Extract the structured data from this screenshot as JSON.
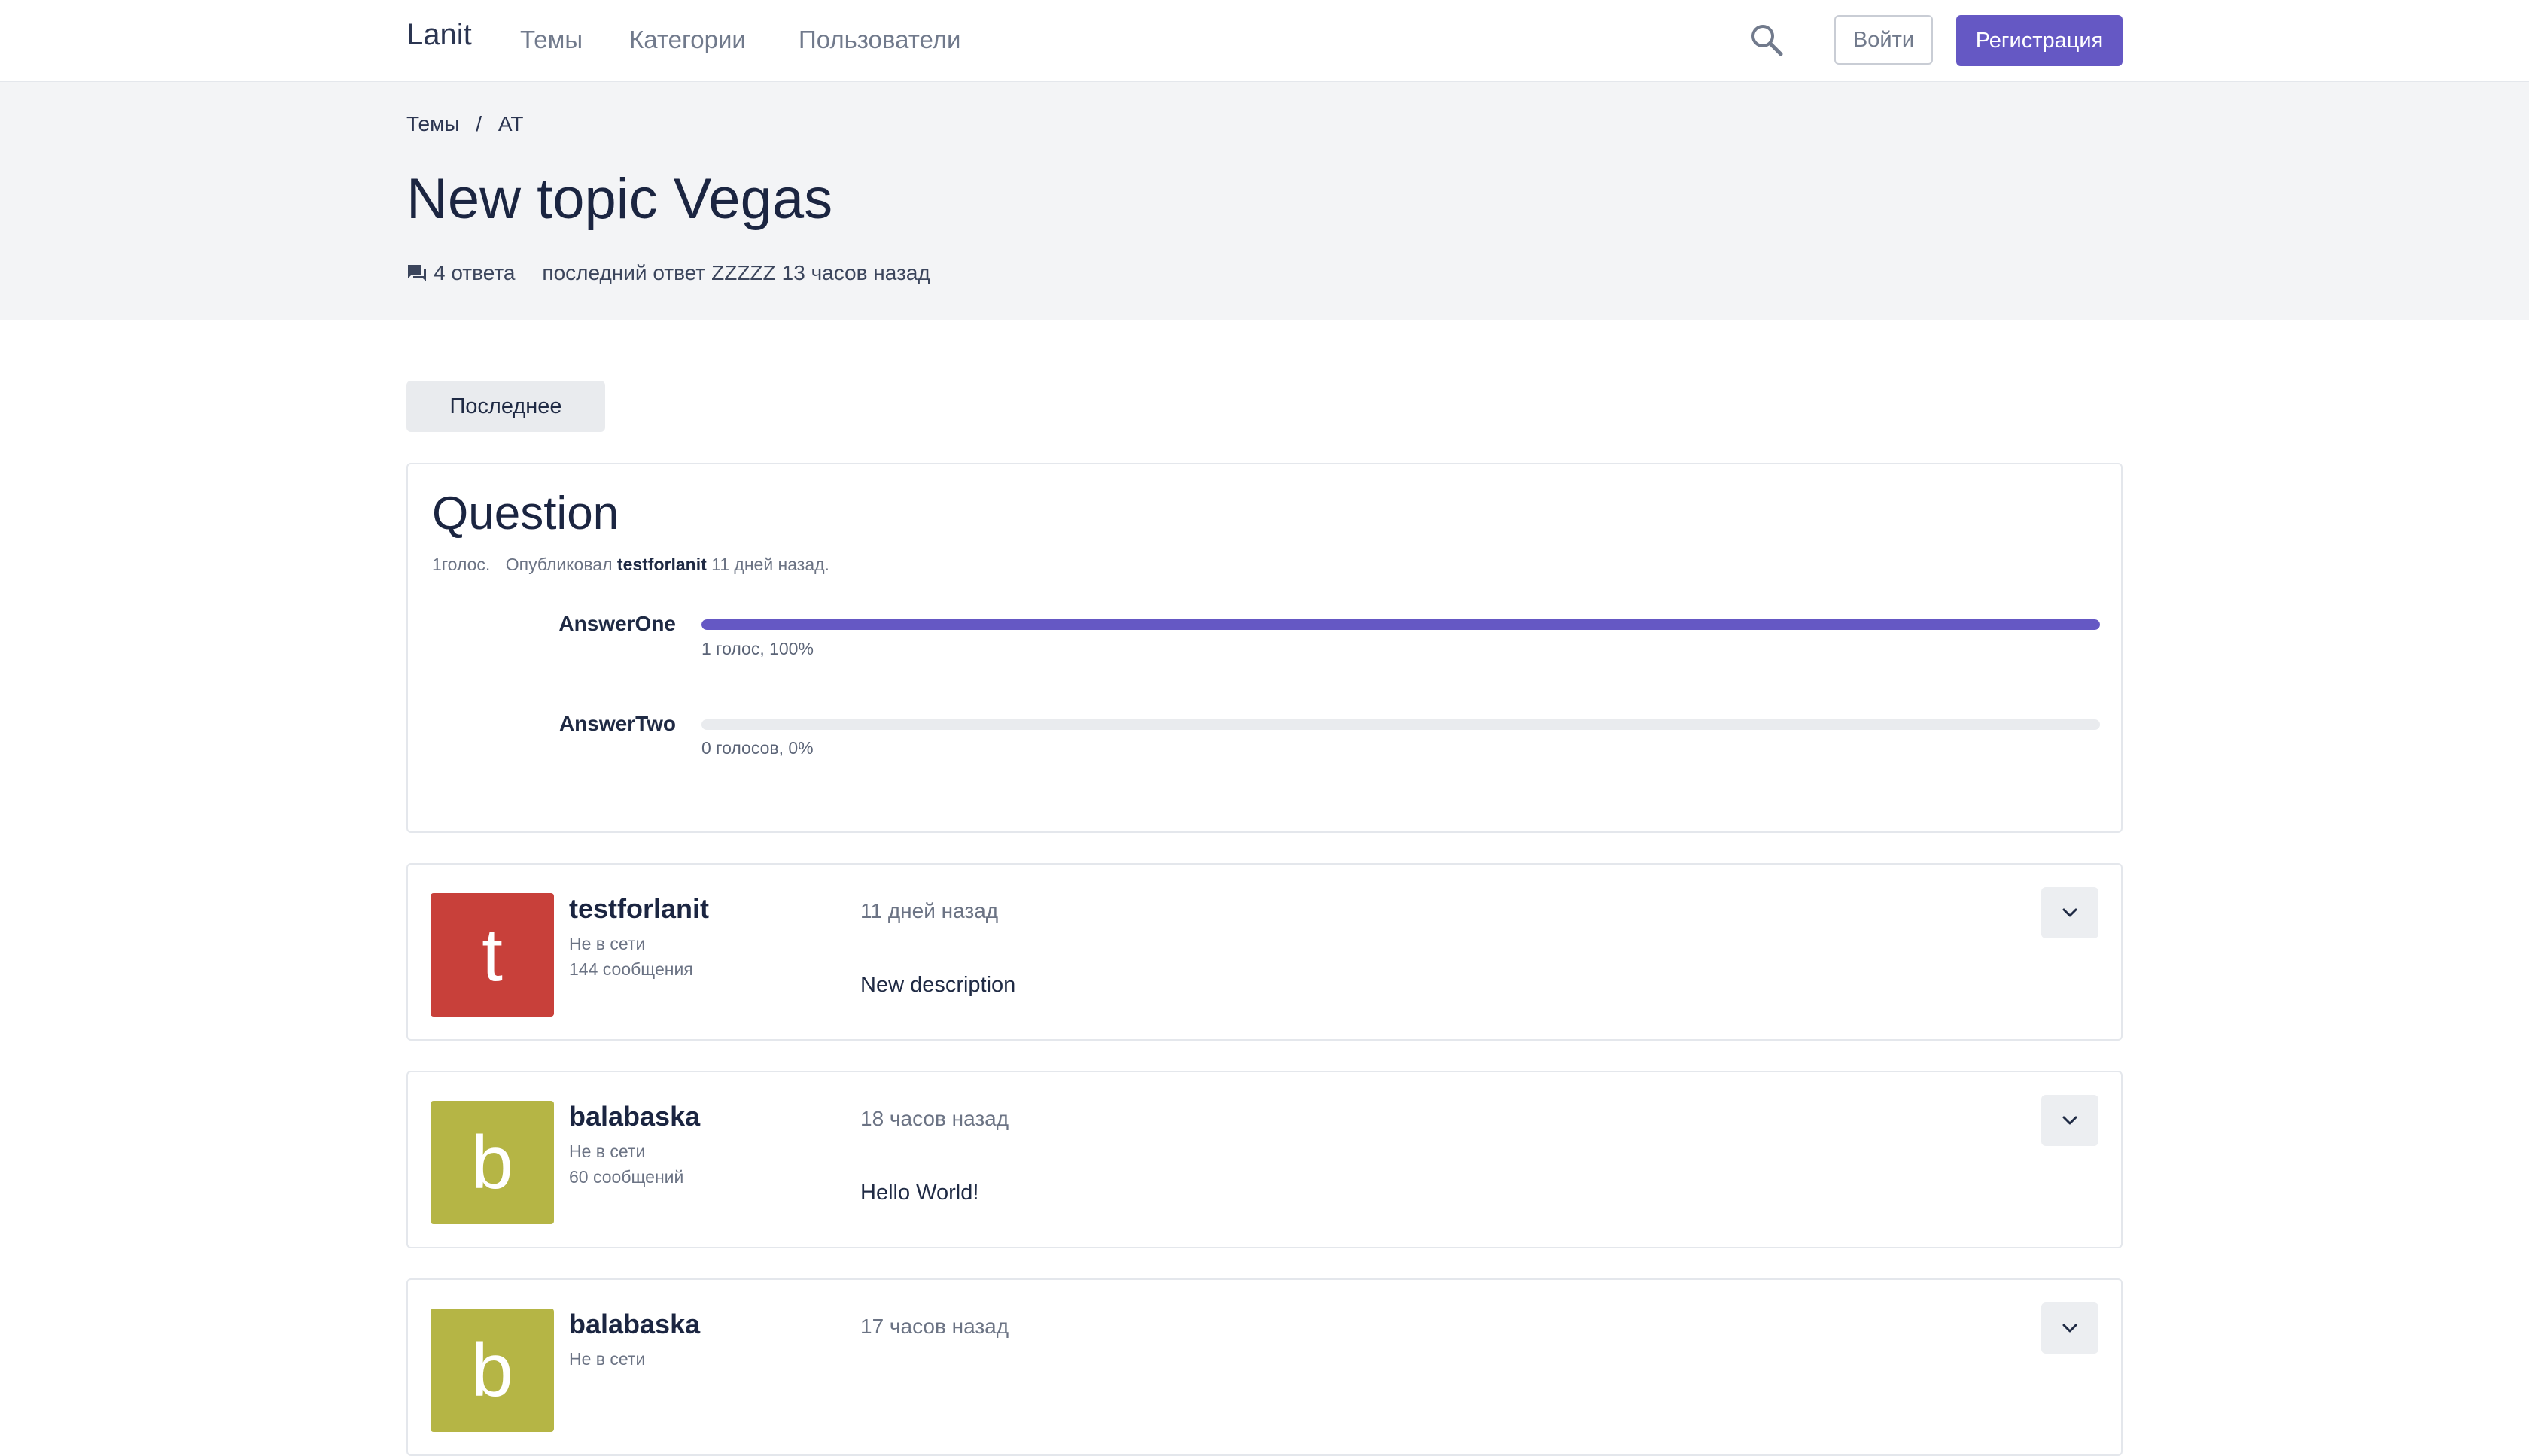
{
  "header": {
    "brand": "Lanit",
    "nav": [
      "Темы",
      "Категории",
      "Пользователи"
    ],
    "login_label": "Войти",
    "register_label": "Регистрация"
  },
  "breadcrumb": [
    "Темы",
    "/",
    "AT"
  ],
  "topic": {
    "title": "New topic Vegas",
    "replies": "4 ответа",
    "last_reply_prefix": "последний ответ",
    "last_reply_user": "ZZZZZ",
    "last_reply_time": "13 часов назад"
  },
  "latest_button": "Последнее",
  "poll": {
    "title": "Question",
    "votes": "1голос.",
    "published_by": "Опубликовал",
    "author": "testforlanit",
    "time": "11 дней назад.",
    "answers": [
      {
        "label": "AnswerOne",
        "caption": "1 голос, 100%",
        "percent": 100
      },
      {
        "label": "AnswerTwo",
        "caption": "0 голосов, 0%",
        "percent": 0
      }
    ]
  },
  "posts": [
    {
      "initial": "t",
      "color": "#c8403a",
      "username": "testforlanit",
      "status": "Не в сети",
      "posts": "144 сообщения",
      "time": "11 дней назад",
      "body": "New description"
    },
    {
      "initial": "b",
      "color": "#b5b545",
      "username": "balabaska",
      "status": "Не в сети",
      "posts": "60 сообщений",
      "time": "18 часов назад",
      "body": "Hello World!"
    },
    {
      "initial": "b",
      "color": "#b5b545",
      "username": "balabaska",
      "status": "Не в сети",
      "posts": "",
      "time": "17 часов назад",
      "body": ""
    }
  ],
  "colors": {
    "accent": "#6558c4",
    "band": "#f3f4f6"
  },
  "icons": [
    "search-icon",
    "reply-icon",
    "chevron-down-icon"
  ]
}
